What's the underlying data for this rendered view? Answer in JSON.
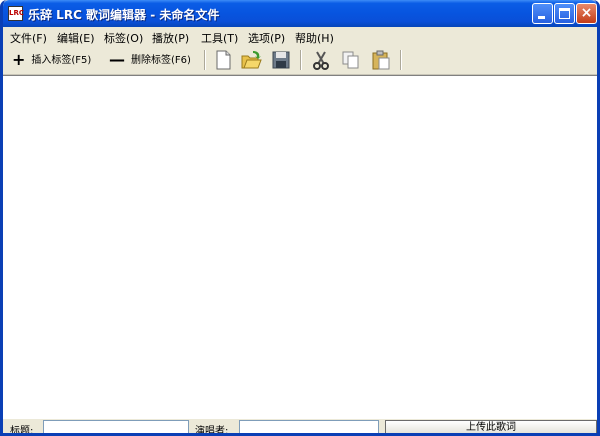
{
  "window": {
    "title": "乐辞 LRC 歌词编辑器 - 未命名文件",
    "icon_text": "LRC"
  },
  "menu": [
    {
      "label": "文件(F)"
    },
    {
      "label": "编辑(E)"
    },
    {
      "label": "标签(O)"
    },
    {
      "label": "播放(P)"
    },
    {
      "label": "工具(T)"
    },
    {
      "label": "选项(P)"
    },
    {
      "label": "帮助(H)"
    }
  ],
  "toolbar": {
    "insert_symbol": "+",
    "insert_label": "插入标签(F5)",
    "delete_symbol": "—",
    "delete_label": "删除标签(F6)",
    "icons": [
      "new-file-icon",
      "open-folder-icon",
      "save-icon",
      "cut-icon",
      "copy-icon",
      "paste-icon"
    ]
  },
  "status": {
    "title_label": "标题:",
    "title_value": "",
    "artist_label": "演唱者:",
    "artist_value": "",
    "upload_label": "上传此歌词"
  },
  "colors": {
    "titlebar": "#0754df",
    "chrome": "#ece9d8",
    "content": "#ffffff"
  }
}
